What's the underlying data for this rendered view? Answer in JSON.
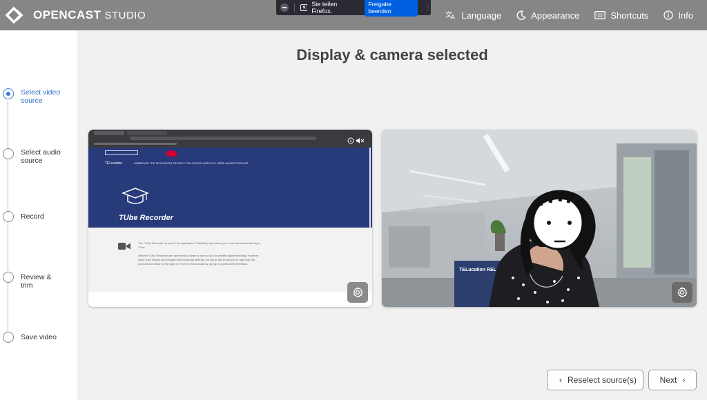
{
  "header": {
    "logo_main": "OPENCAST",
    "logo_sub": "STUDIO",
    "nav": [
      {
        "label": "Language",
        "icon": "language-icon"
      },
      {
        "label": "Appearance",
        "icon": "moon-icon"
      },
      {
        "label": "Shortcuts",
        "icon": "keyboard-icon"
      },
      {
        "label": "Info",
        "icon": "info-icon"
      }
    ]
  },
  "share_bar": {
    "message": "Sie teilen Firefox.",
    "stop_label": "Freigabe beenden"
  },
  "steps": [
    {
      "label": "Select video source",
      "active": true
    },
    {
      "label": "Select audio source",
      "active": false
    },
    {
      "label": "Record",
      "active": false
    },
    {
      "label": "Review & trim",
      "active": false
    },
    {
      "label": "Save video",
      "active": false
    }
  ],
  "main": {
    "title": "Display & camera selected"
  },
  "screen_preview": {
    "site_nav": "HOMEPAGE     THE TELUCATION PROJECT     TELUCATION ARTICLES     USER GUIDES     PODCAST",
    "site_brand": "TELucation",
    "site_heading": "TUbe Recorder",
    "site_paragraph_1": "The \"TUbe Recorder\" is part of the application TUbeShop and allows you to record videos directly in TUbe.",
    "site_paragraph_2": "With the TUbe Recorder we have tried to create a way for you to simplify digital teaching. However, since each device and program has individual settings, we would like to ask you to take this into account and show us the gaps or errors in this manual by giving us constructive feedback."
  },
  "camera_preview": {
    "poster_title": "TELucation RELAUNCH"
  },
  "buttons": {
    "back_label": "Reselect source(s)",
    "next_label": "Next"
  },
  "colors": {
    "header_bg": "#868686",
    "accent": "#3a7bd5",
    "share_stop": "#0061e0"
  }
}
